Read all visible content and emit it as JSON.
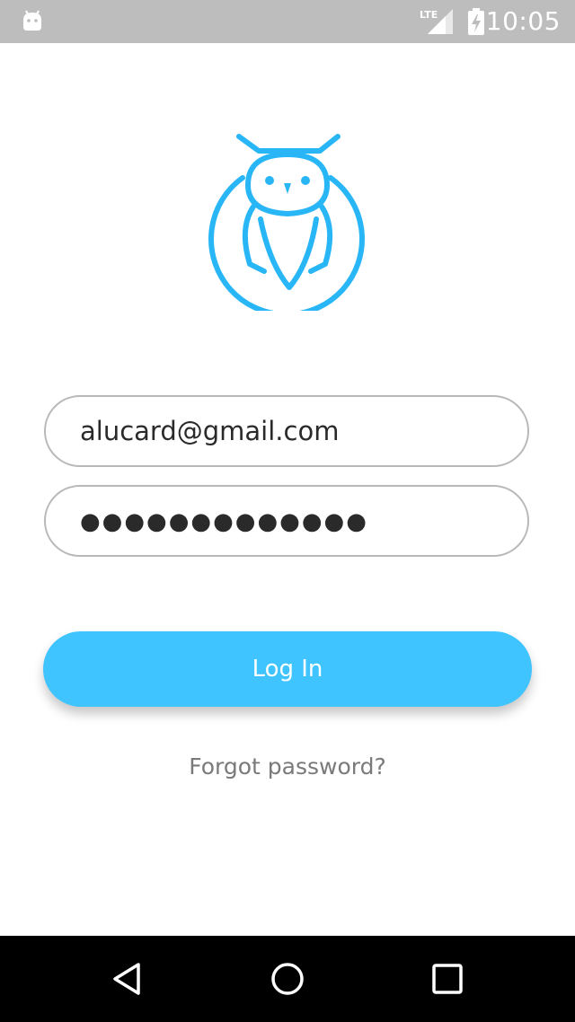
{
  "status_bar": {
    "time": "10:05",
    "network": "LTE",
    "icons": [
      "android-debug-icon",
      "lte-signal-icon",
      "battery-charging-icon"
    ]
  },
  "logo": {
    "icon": "owl-logo-icon",
    "color": "#29b6f6"
  },
  "login_form": {
    "email_value": "alucard@gmail.com",
    "password_masked": "●●●●●●●●●●●●●",
    "submit_label": "Log In",
    "forgot_label": "Forgot password?"
  },
  "colors": {
    "accent": "#40c4ff",
    "status_bar_bg": "#bdbdbd",
    "nav_bar_bg": "#000000",
    "field_border": "#b8b8b8"
  },
  "nav_bar": {
    "icons": [
      "back-icon",
      "home-icon",
      "recents-icon"
    ]
  }
}
